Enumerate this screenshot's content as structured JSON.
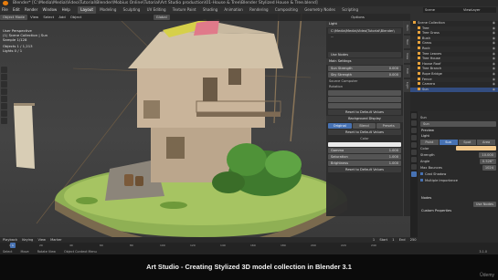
{
  "window": {
    "title": "Blender* [C:\\Media\\Media\\Video\\Tutorial\\Blender\\Mobius Online\\Tutorial\\Art Studio production\\01-House & Tree\\Blender Stylized House & Tree.blend]"
  },
  "menu": {
    "items": [
      "File",
      "Edit",
      "Render",
      "Window",
      "Help"
    ],
    "workspaces": [
      "Layout",
      "Modeling",
      "Sculpting",
      "UV Editing",
      "Texture Paint",
      "Shading",
      "Animation",
      "Rendering",
      "Compositing",
      "Geometry Nodes",
      "Scripting"
    ],
    "active_workspace": "Layout",
    "scene": "Scene",
    "view_layer": "ViewLayer"
  },
  "viewport": {
    "header": {
      "mode": "Object Mode",
      "menus": [
        "View",
        "Select",
        "Add",
        "Object"
      ],
      "transform": "Global",
      "options": "Options"
    },
    "info": {
      "view": "User Perspective",
      "collection": "(1) Scene Collection | Sun",
      "samples": "Sample 1/128",
      "objects": "Objects   1 / 1,213",
      "lights": "Lights   0 / 1"
    }
  },
  "light_panel": {
    "name": "Light",
    "path": "C:\\Media\\Media\\Video\\Tutorial\\Blender\\ ...",
    "use_node": "Use Nodes",
    "sections": {
      "main": "Main Settings",
      "sun_strength_label": "Sun Strength",
      "sun_strength": "0.000",
      "sky_strength_label": "Sky Strength",
      "sky_strength": "0.000",
      "source": "Source Computer",
      "rotation": "Rotation",
      "reset1": "Reset to Default Values",
      "background": "Background Display",
      "bg_options": [
        "Original",
        "Blend",
        "Presets"
      ],
      "reset2": "Reset to Default Values",
      "color": "Color",
      "fields": [
        {
          "label": "Gamma",
          "value": "1.000"
        },
        {
          "label": "Saturation",
          "value": "1.000"
        },
        {
          "label": "Brightness",
          "value": "1.000"
        }
      ],
      "reset3": "Reset to Default Values"
    }
  },
  "side_tabs": [
    "Item",
    "Tool",
    "View",
    "Edit",
    "Light"
  ],
  "outliner": {
    "header": "Scene Collection",
    "rows": [
      {
        "name": "Scene Collection",
        "selected": false
      },
      {
        "name": "Tree",
        "selected": false
      },
      {
        "name": "Tree Grass",
        "selected": false
      },
      {
        "name": "Bush",
        "selected": false
      },
      {
        "name": "Grass",
        "selected": false
      },
      {
        "name": "Rock",
        "selected": false
      },
      {
        "name": "Tree Leaves",
        "selected": false
      },
      {
        "name": "Tree House",
        "selected": false
      },
      {
        "name": "House Roof",
        "selected": false
      },
      {
        "name": "Tree Branch",
        "selected": false
      },
      {
        "name": "Rope Bridge",
        "selected": false
      },
      {
        "name": "Fence",
        "selected": false
      },
      {
        "name": "Camera",
        "selected": false
      },
      {
        "name": "Sun",
        "selected": true
      }
    ]
  },
  "properties": {
    "object": "Sun",
    "data": "Sun",
    "sections": [
      "Preview",
      "Light"
    ],
    "light_types": [
      "Point",
      "Sun",
      "Spot",
      "Area"
    ],
    "active_type": "Sun",
    "fields": [
      {
        "label": "Color",
        "value": ""
      },
      {
        "label": "Strength",
        "value": "10.000"
      },
      {
        "label": "Angle",
        "value": "0.526°"
      },
      {
        "label": "Max Bounces",
        "value": "1024"
      }
    ],
    "checks": [
      "Cast Shadow",
      "Multiple Importance"
    ],
    "nodes_section": "Nodes",
    "use_nodes_button": "Use Nodes",
    "custom_props": "Custom Properties",
    "light_color": "#f2c88c"
  },
  "timeline": {
    "menus": [
      "Playback",
      "Keying",
      "View",
      "Marker"
    ],
    "current_frame": "1",
    "start_label": "Start",
    "start": "1",
    "end_label": "End",
    "end": "250",
    "ticks": [
      "0",
      "20",
      "40",
      "60",
      "80",
      "100",
      "120",
      "140",
      "160",
      "180",
      "200",
      "220",
      "240"
    ]
  },
  "status": {
    "items": [
      "Select",
      "Move",
      "Rotate View",
      "Object Context Menu"
    ],
    "version": "3.1.0"
  },
  "caption": {
    "text": "Art Studio - Creating Stylized 3D model collection in Blender 3.1",
    "watermark": "Ûdemy"
  },
  "colors": {
    "accent": "#4772b3",
    "blender_orange": "#e87d0d"
  }
}
